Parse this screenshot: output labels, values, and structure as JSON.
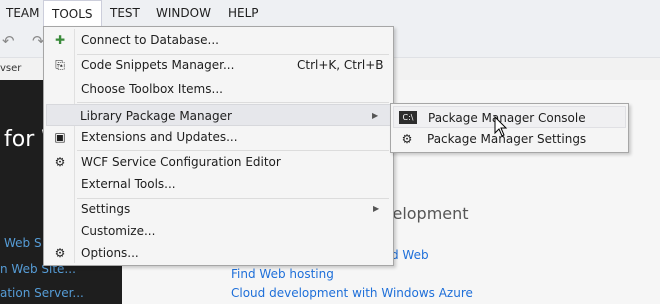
{
  "menubar": {
    "items": [
      {
        "label": "TEAM"
      },
      {
        "label": "TOOLS",
        "active": true
      },
      {
        "label": "TEST"
      },
      {
        "label": "WINDOW"
      },
      {
        "label": "HELP"
      }
    ]
  },
  "toolbar": {
    "icons": [
      "undo-icon",
      "redo-icon"
    ]
  },
  "tab_strip": {
    "partial_label": "vser"
  },
  "left_panel": {
    "welcome_partial": "for W",
    "links": [
      "Web S",
      "n Web Site...",
      "ation Server..."
    ]
  },
  "content": {
    "heading_partial": "velopment",
    "links": [
      "d Web",
      "Find Web hosting",
      "Cloud development with Windows Azure"
    ]
  },
  "tools_menu": {
    "items": [
      {
        "label": "Connect to Database...",
        "icon": "connect-database-icon",
        "glyph": "✚"
      },
      {
        "label": "Code Snippets Manager...",
        "icon": "code-snippets-icon",
        "glyph": "⎘",
        "shortcut": "Ctrl+K, Ctrl+B"
      },
      {
        "label": "Choose Toolbox Items..."
      },
      {
        "label": "Library Package Manager",
        "submenu": true,
        "highlighted": true
      },
      {
        "label": "Extensions and Updates...",
        "icon": "extensions-icon",
        "glyph": "▣"
      },
      {
        "label": "WCF Service Configuration Editor",
        "icon": "wcf-config-icon",
        "glyph": "⚙"
      },
      {
        "label": "External Tools..."
      },
      {
        "label": "Settings",
        "submenu": true
      },
      {
        "label": "Customize..."
      },
      {
        "label": "Options...",
        "icon": "options-gear-icon",
        "glyph": "⚙"
      }
    ]
  },
  "library_submenu": {
    "items": [
      {
        "label": "Package Manager Console",
        "icon": "console-icon",
        "glyph": "C:\\",
        "highlighted": true
      },
      {
        "label": "Package Manager Settings",
        "icon": "settings-gear-icon",
        "glyph": "⚙"
      }
    ]
  },
  "colors": {
    "menu_bg": "#f5f5f5",
    "highlight": "#e6e7eb",
    "link": "#1e6fd9",
    "dark_panel": "#1e1e1e"
  }
}
